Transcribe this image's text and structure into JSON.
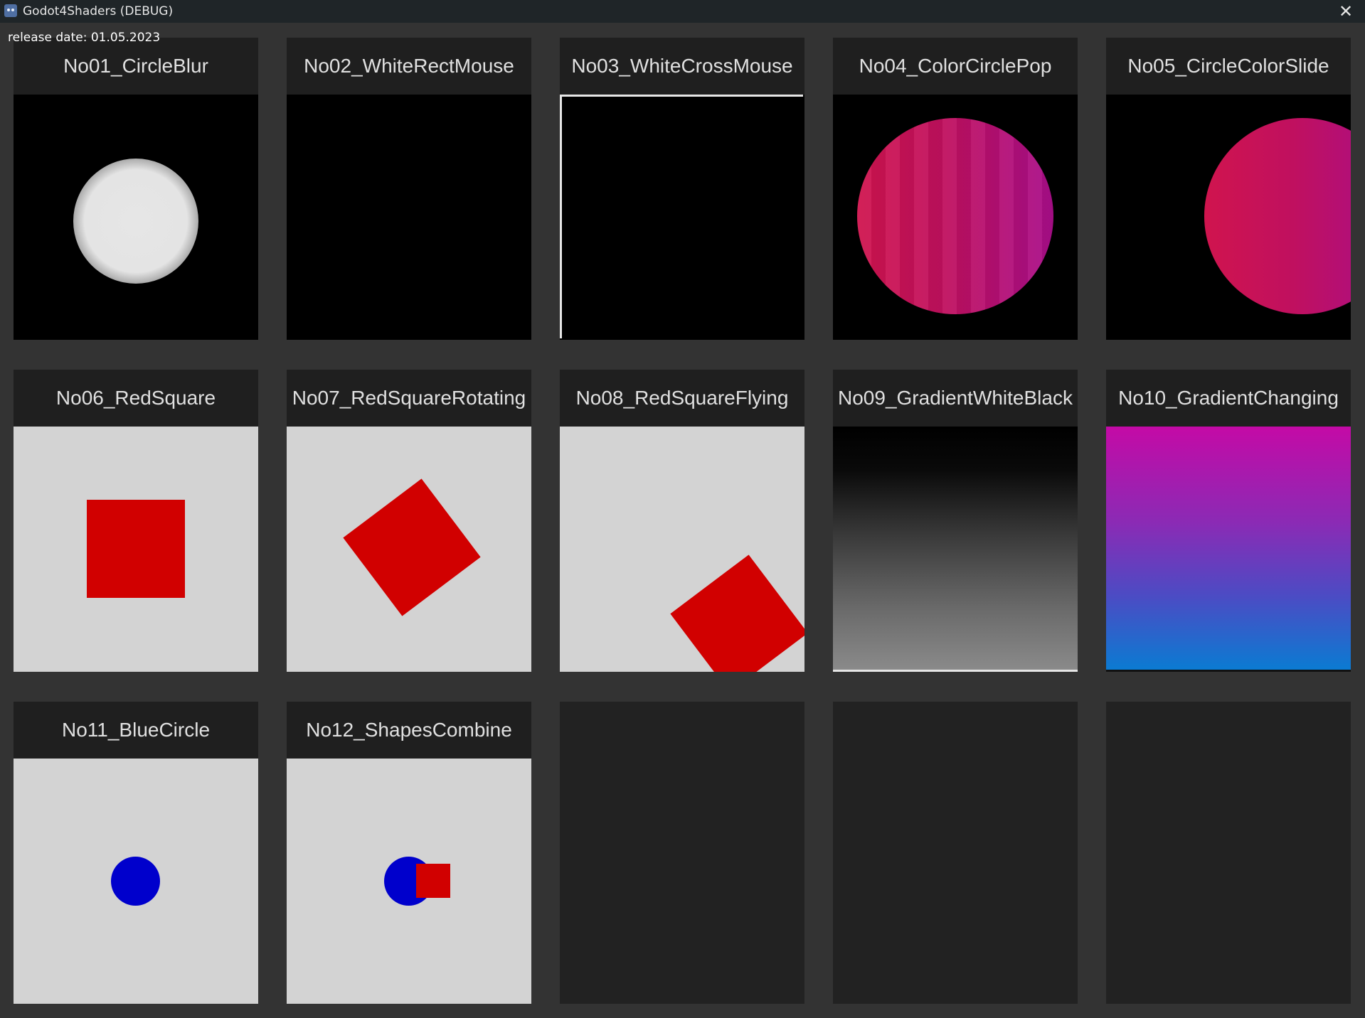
{
  "window": {
    "title": "Godot4Shaders (DEBUG)",
    "app_icon": "godot-icon",
    "close_icon": "close-icon",
    "close_glyph": "✕"
  },
  "release_text": "release date: 01.05.2023",
  "shaders": [
    {
      "name": "No01_CircleBlur"
    },
    {
      "name": "No02_WhiteRectMouse"
    },
    {
      "name": "No03_WhiteCrossMouse"
    },
    {
      "name": "No04_ColorCirclePop"
    },
    {
      "name": "No05_CircleColorSlide"
    },
    {
      "name": "No06_RedSquare"
    },
    {
      "name": "No07_RedSquareRotating"
    },
    {
      "name": "No08_RedSquareFlying"
    },
    {
      "name": "No09_GradientWhiteBlack"
    },
    {
      "name": "No10_GradientChanging"
    },
    {
      "name": "No11_BlueCircle"
    },
    {
      "name": "No12_ShapesCombine"
    }
  ],
  "colors": {
    "background": "#333333",
    "card": "#222222",
    "title_bar": "#1f2528",
    "shape_red": "#d10000",
    "shape_blue": "#0000cc"
  }
}
